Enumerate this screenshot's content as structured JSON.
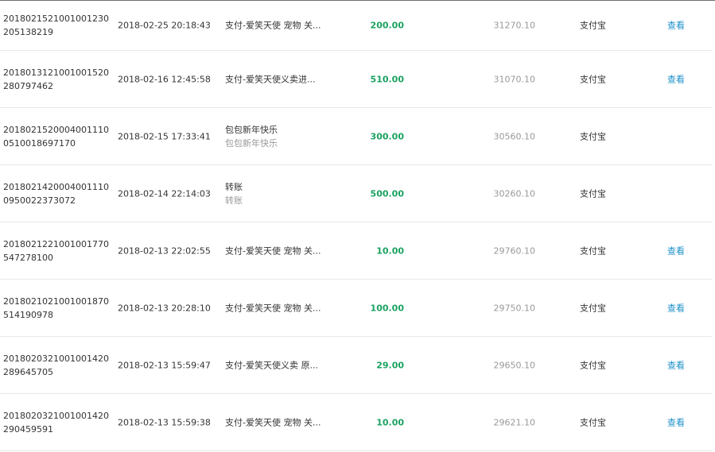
{
  "transactions": [
    {
      "id": "2018021521001001230205138219",
      "time": "2018-02-25 20:18:43",
      "name": "支付-爱笑天使 宠物 关...",
      "sub": "",
      "amount": "200.00",
      "balance": "31270.10",
      "channel": "支付宝",
      "action": "查看"
    },
    {
      "id": "2018013121001001520280797462",
      "time": "2018-02-16 12:45:58",
      "name": "支付-爱笑天使义卖进...",
      "sub": "",
      "amount": "510.00",
      "balance": "31070.10",
      "channel": "支付宝",
      "action": "查看"
    },
    {
      "id": "201802152000400111005100186971​70",
      "time": "2018-02-15 17:33:41",
      "name": "包包新年快乐",
      "sub": "包包新年快乐",
      "amount": "300.00",
      "balance": "30560.10",
      "channel": "支付宝",
      "action": ""
    },
    {
      "id": "2018021420004001110095002237​3072",
      "time": "2018-02-14 22:14:03",
      "name": "转账",
      "sub": "转账",
      "amount": "500.00",
      "balance": "30260.10",
      "channel": "支付宝",
      "action": ""
    },
    {
      "id": "2018021221001001770547278100",
      "time": "2018-02-13 22:02:55",
      "name": "支付-爱笑天使 宠物 关...",
      "sub": "",
      "amount": "10.00",
      "balance": "29760.10",
      "channel": "支付宝",
      "action": "查看"
    },
    {
      "id": "2018021021001001870514190978",
      "time": "2018-02-13 20:28:10",
      "name": "支付-爱笑天使 宠物 关...",
      "sub": "",
      "amount": "100.00",
      "balance": "29750.10",
      "channel": "支付宝",
      "action": "查看"
    },
    {
      "id": "2018020321001001420289645705",
      "time": "2018-02-13 15:59:47",
      "name": "支付-爱笑天使义卖 原...",
      "sub": "",
      "amount": "29.00",
      "balance": "29650.10",
      "channel": "支付宝",
      "action": "查看"
    },
    {
      "id": "2018020321001001420290459591",
      "time": "2018-02-13 15:59:38",
      "name": "支付-爱笑天使 宠物 关...",
      "sub": "",
      "amount": "10.00",
      "balance": "29621.10",
      "channel": "支付宝",
      "action": "查看"
    }
  ]
}
